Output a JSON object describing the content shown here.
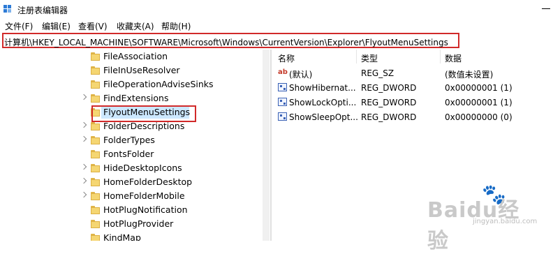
{
  "window": {
    "title": "注册表编辑器"
  },
  "menu": [
    "文件(F)",
    "编辑(E)",
    "查看(V)",
    "收藏夹(A)",
    "帮助(H)"
  ],
  "address": {
    "path": "计算机\\HKEY_LOCAL_MACHINE\\SOFTWARE\\Microsoft\\Windows\\CurrentVersion\\Explorer\\FlyoutMenuSettings"
  },
  "tree": {
    "items": [
      {
        "label": "FileAssociation",
        "expandable": false
      },
      {
        "label": "FileInUseResolver",
        "expandable": false
      },
      {
        "label": "FileOperationAdviseSinks",
        "expandable": false
      },
      {
        "label": "FindExtensions",
        "expandable": true
      },
      {
        "label": "FlyoutMenuSettings",
        "expandable": false,
        "selected": true
      },
      {
        "label": "FolderDescriptions",
        "expandable": true
      },
      {
        "label": "FolderTypes",
        "expandable": true
      },
      {
        "label": "FontsFolder",
        "expandable": false
      },
      {
        "label": "HideDesktopIcons",
        "expandable": true
      },
      {
        "label": "HomeFolderDesktop",
        "expandable": true
      },
      {
        "label": "HomeFolderMobile",
        "expandable": true
      },
      {
        "label": "HotPlugNotification",
        "expandable": false
      },
      {
        "label": "HotPlugProvider",
        "expandable": false
      },
      {
        "label": "KindMap",
        "expandable": false
      }
    ]
  },
  "values": {
    "headers": {
      "name": "名称",
      "type": "类型",
      "data": "数据"
    },
    "rows": [
      {
        "icon": "string-value-icon",
        "name": "(默认)",
        "type": "REG_SZ",
        "data": "(数值未设置)"
      },
      {
        "icon": "binary-value-icon",
        "name": "ShowHibernat...",
        "type": "REG_DWORD",
        "data": "0x00000001 (1)"
      },
      {
        "icon": "binary-value-icon",
        "name": "ShowLockOpti...",
        "type": "REG_DWORD",
        "data": "0x00000001 (1)"
      },
      {
        "icon": "binary-value-icon",
        "name": "ShowSleepOpt...",
        "type": "REG_DWORD",
        "data": "0x00000000 (0)"
      }
    ]
  },
  "watermark": {
    "brand": "Baidu经验",
    "site": "jingyan.baidu.com"
  },
  "colors": {
    "highlight_border": "#d12a2a",
    "selection": "#cce8ff",
    "folder": "#f5d672"
  }
}
